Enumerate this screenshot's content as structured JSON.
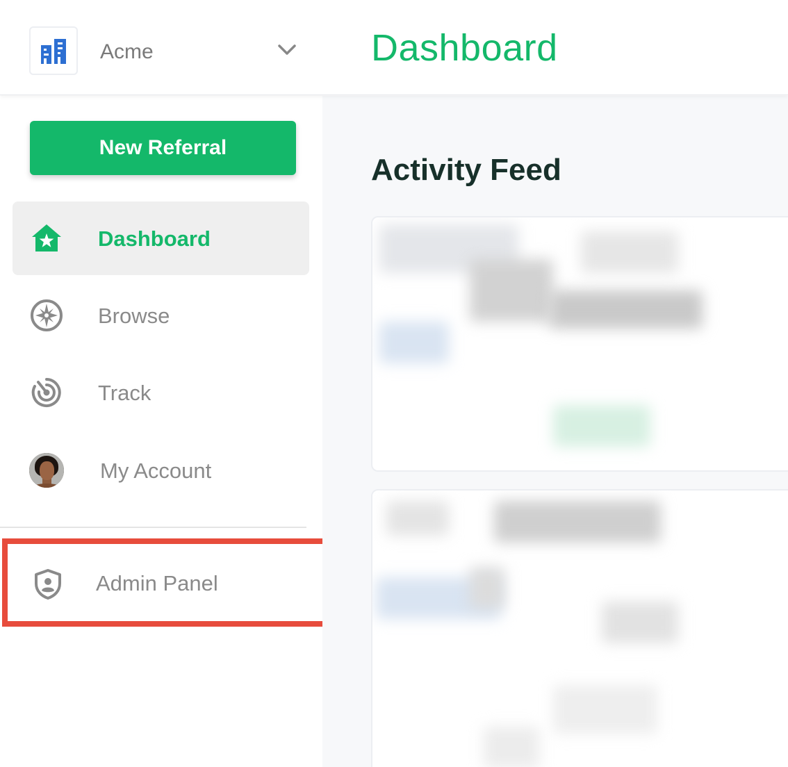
{
  "header": {
    "org_name": "Acme",
    "page_title": "Dashboard",
    "org_logo_icon": "building-icon",
    "switcher_icon": "chevron-down-icon"
  },
  "sidebar": {
    "new_referral_label": "New Referral",
    "items": [
      {
        "label": "Dashboard",
        "icon": "home-star-icon",
        "active": true
      },
      {
        "label": "Browse",
        "icon": "compass-icon",
        "active": false
      },
      {
        "label": "Track",
        "icon": "radar-icon",
        "active": false
      },
      {
        "label": "My Account",
        "icon": "avatar",
        "active": false
      }
    ],
    "admin": {
      "label": "Admin Panel",
      "icon": "shield-user-icon",
      "highlighted": true
    }
  },
  "main": {
    "section_title": "Activity Feed"
  },
  "colors": {
    "accent": "#14b86a",
    "highlight": "#e74c3c",
    "logo_blue": "#2d6fd2",
    "title_dark": "#17302a"
  }
}
